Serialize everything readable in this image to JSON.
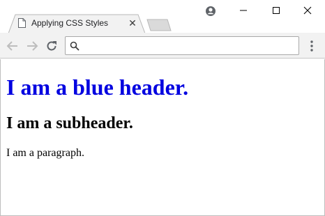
{
  "window": {
    "tab": {
      "title": "Applying CSS Styles",
      "close_glyph": "✕",
      "icon": "page-icon"
    },
    "controls": [
      "account-icon",
      "minimize-icon",
      "maximize-icon",
      "close-icon"
    ]
  },
  "toolbar": {
    "address": {
      "value": "",
      "placeholder": ""
    },
    "icons": [
      "back-arrow-icon",
      "forward-arrow-icon",
      "reload-icon",
      "search-icon",
      "kebab-menu-icon"
    ]
  },
  "page": {
    "heading": "I am a blue header.",
    "subheading": "I am a subheader.",
    "paragraph": "I am a paragraph."
  },
  "colors": {
    "heading": "#0000e0",
    "toolbar_bg": "#f2f2f2",
    "tab_bg": "#f2f2f2"
  }
}
